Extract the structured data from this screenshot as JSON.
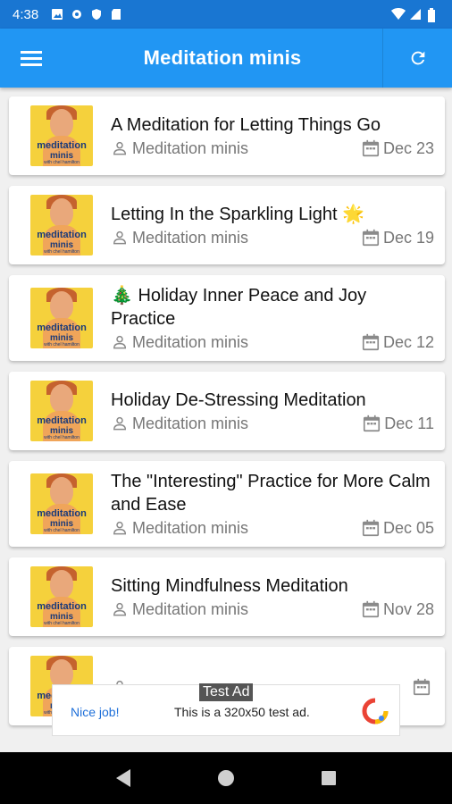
{
  "status_bar": {
    "time": "4:38"
  },
  "app_bar": {
    "title": "Meditation minis"
  },
  "thumbnail": {
    "word1": "meditation",
    "word2": "minis",
    "sub": "with chel hamilton"
  },
  "episodes": [
    {
      "title": "A Meditation for Letting Things Go",
      "author": "Meditation minis",
      "date": "Dec 23"
    },
    {
      "title": "Letting In the Sparkling Light 🌟",
      "author": "Meditation minis",
      "date": "Dec 19"
    },
    {
      "title": "🎄 Holiday Inner Peace and Joy Practice",
      "author": "Meditation minis",
      "date": "Dec 12"
    },
    {
      "title": "Holiday De-Stressing Meditation",
      "author": "Meditation minis",
      "date": "Dec 11"
    },
    {
      "title": "The \"Interesting\" Practice for More Calm and Ease",
      "author": "Meditation minis",
      "date": "Dec 05"
    },
    {
      "title": "Sitting Mindfulness Meditation",
      "author": "Meditation minis",
      "date": "Nov 28"
    },
    {
      "title": "",
      "author": "",
      "date": ""
    }
  ],
  "ad": {
    "tag": "Test Ad",
    "left_text": "Nice job!",
    "main_text": "This is a 320x50 test ad."
  },
  "colors": {
    "primary": "#2196f3",
    "status": "#1976d2"
  }
}
